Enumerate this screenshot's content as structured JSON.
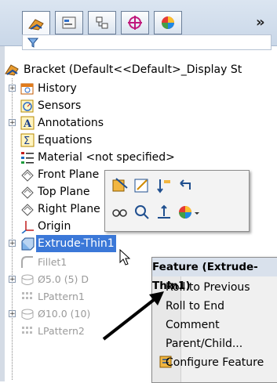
{
  "panel": {
    "tabs": [
      {
        "name": "feature-manager-tab",
        "active": true
      },
      {
        "name": "property-manager-tab",
        "active": false
      },
      {
        "name": "configuration-manager-tab",
        "active": false
      },
      {
        "name": "dimxpert-manager-tab",
        "active": false
      },
      {
        "name": "display-manager-tab",
        "active": false
      }
    ],
    "overflow_label": "»",
    "filter_icon": "filter-icon"
  },
  "tree": {
    "root": "Bracket  (Default<<Default>_Display St",
    "items": [
      {
        "label": "History",
        "icon": "history-icon"
      },
      {
        "label": "Sensors",
        "icon": "sensors-icon"
      },
      {
        "label": "Annotations",
        "icon": "annotations-icon"
      },
      {
        "label": "Equations",
        "icon": "equations-icon"
      },
      {
        "label": "Material <not specified>",
        "icon": "material-icon"
      },
      {
        "label": "Front Plane",
        "icon": "plane-icon"
      },
      {
        "label": "Top Plane",
        "icon": "plane-icon"
      },
      {
        "label": "Right Plane",
        "icon": "plane-icon"
      },
      {
        "label": "Origin",
        "icon": "origin-icon"
      },
      {
        "label": "Extrude-Thin1",
        "icon": "extrude-icon"
      },
      {
        "label": "Fillet1",
        "icon": "fillet-icon"
      },
      {
        "label": "Ø5.0 (5) D",
        "icon": "hole-icon"
      },
      {
        "label": "LPattern1",
        "icon": "pattern-icon"
      },
      {
        "label": "Ø10.0 (10)",
        "icon": "hole-icon"
      },
      {
        "label": "LPattern2",
        "icon": "pattern-icon"
      }
    ]
  },
  "context_menu": {
    "header": "Feature (Extrude-Thin1)",
    "items": [
      "Roll to Previous",
      "Roll to End",
      "Comment",
      "Parent/Child...",
      "Configure Feature"
    ]
  }
}
